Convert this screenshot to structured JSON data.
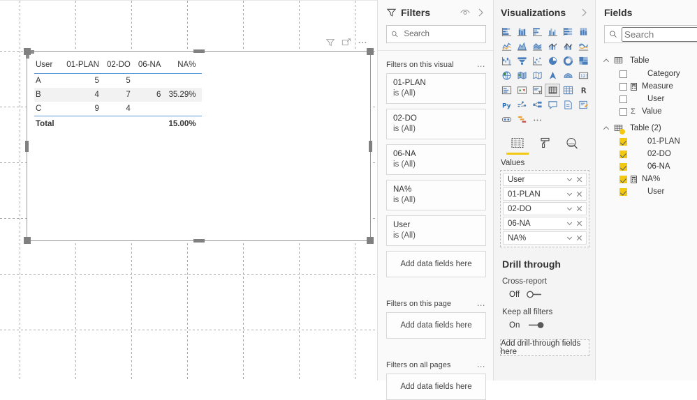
{
  "canvas": {
    "visual_header_icons": [
      "filter-icon",
      "focus-mode-icon",
      "more-options-icon"
    ],
    "table_visual": {
      "columns": [
        "User",
        "01-PLAN",
        "02-DO",
        "06-NA",
        "NA%"
      ],
      "rows": [
        {
          "user": "A",
          "plan": "5",
          "do": "5",
          "na": "",
          "napct": ""
        },
        {
          "user": "B",
          "plan": "4",
          "do": "7",
          "na": "6",
          "napct": "35.29%"
        },
        {
          "user": "C",
          "plan": "9",
          "do": "4",
          "na": "",
          "napct": ""
        }
      ],
      "total": {
        "label": "Total",
        "plan": "",
        "do": "",
        "na": "",
        "napct": "15.00%"
      }
    }
  },
  "filters": {
    "title": "Filters",
    "search_placeholder": "Search",
    "sections": [
      {
        "label": "Filters on this visual",
        "cards": [
          {
            "name": "01-PLAN",
            "value": "is (All)"
          },
          {
            "name": "02-DO",
            "value": "is (All)"
          },
          {
            "name": "06-NA",
            "value": "is (All)"
          },
          {
            "name": "NA%",
            "value": "is (All)"
          },
          {
            "name": "User",
            "value": "is (All)"
          }
        ],
        "dropzone": "Add data fields here"
      },
      {
        "label": "Filters on this page",
        "cards": [],
        "dropzone": "Add data fields here"
      },
      {
        "label": "Filters on all pages",
        "cards": [],
        "dropzone": "Add data fields here"
      }
    ]
  },
  "visualizations": {
    "title": "Visualizations",
    "icons": [
      "stacked-bar-chart-icon",
      "stacked-column-chart-icon",
      "clustered-bar-chart-icon",
      "clustered-column-chart-icon",
      "100-stacked-bar-chart-icon",
      "100-stacked-column-chart-icon",
      "line-chart-icon",
      "area-chart-icon",
      "stacked-area-chart-icon",
      "line-stacked-column-chart-icon",
      "line-clustered-column-chart-icon",
      "ribbon-chart-icon",
      "waterfall-chart-icon",
      "funnel-chart-icon",
      "scatter-chart-icon",
      "pie-chart-icon",
      "donut-chart-icon",
      "treemap-icon",
      "map-icon",
      "filled-map-icon",
      "shape-map-icon",
      "arcgis-map-icon",
      "azure-map-icon",
      "card-icon",
      "multi-row-card-icon",
      "kpi-icon",
      "slicer-icon",
      "table-icon",
      "matrix-icon",
      "r-script-visual-icon",
      "python-visual-icon",
      "decomposition-tree-icon",
      "key-influencers-icon",
      "qna-icon",
      "paginated-report-icon",
      "smart-narrative-icon",
      "power-apps-icon",
      "power-automate-icon",
      "more-visuals-icon"
    ],
    "selected_icon": "table-icon",
    "tabs": [
      {
        "name": "fields-tab",
        "icon": "fields-grid-icon",
        "active": true
      },
      {
        "name": "format-tab",
        "icon": "paint-roller-icon",
        "active": false
      },
      {
        "name": "analytics-tab",
        "icon": "analytics-magnifier-icon",
        "active": false
      }
    ],
    "well_label": "Values",
    "well_items": [
      "User",
      "01-PLAN",
      "02-DO",
      "06-NA",
      "NA%"
    ],
    "drill_through": {
      "title": "Drill through",
      "cross_report_label": "Cross-report",
      "cross_report_state": "Off",
      "keep_filters_label": "Keep all filters",
      "keep_filters_state": "On",
      "dropzone": "Add drill-through fields here"
    }
  },
  "fields": {
    "title": "Fields",
    "search_placeholder": "Search",
    "tables": [
      {
        "name": "Table",
        "expanded": true,
        "items": [
          {
            "label": "Category",
            "checked": false,
            "icon": ""
          },
          {
            "label": "Measure",
            "checked": false,
            "icon": "measure-icon"
          },
          {
            "label": "User",
            "checked": false,
            "icon": ""
          },
          {
            "label": "Value",
            "checked": false,
            "icon": "sigma-icon"
          }
        ]
      },
      {
        "name": "Table (2)",
        "expanded": true,
        "items": [
          {
            "label": "01-PLAN",
            "checked": true,
            "icon": ""
          },
          {
            "label": "02-DO",
            "checked": true,
            "icon": ""
          },
          {
            "label": "06-NA",
            "checked": true,
            "icon": ""
          },
          {
            "label": "NA%",
            "checked": true,
            "icon": "measure-icon"
          },
          {
            "label": "User",
            "checked": true,
            "icon": ""
          }
        ]
      }
    ]
  },
  "colors": {
    "accent_yellow": "#f2c811",
    "table_rule_blue": "#5b9bd5",
    "viz_icon_blue": "#4a7ebb",
    "pane_bg": "#f4f4f4"
  }
}
